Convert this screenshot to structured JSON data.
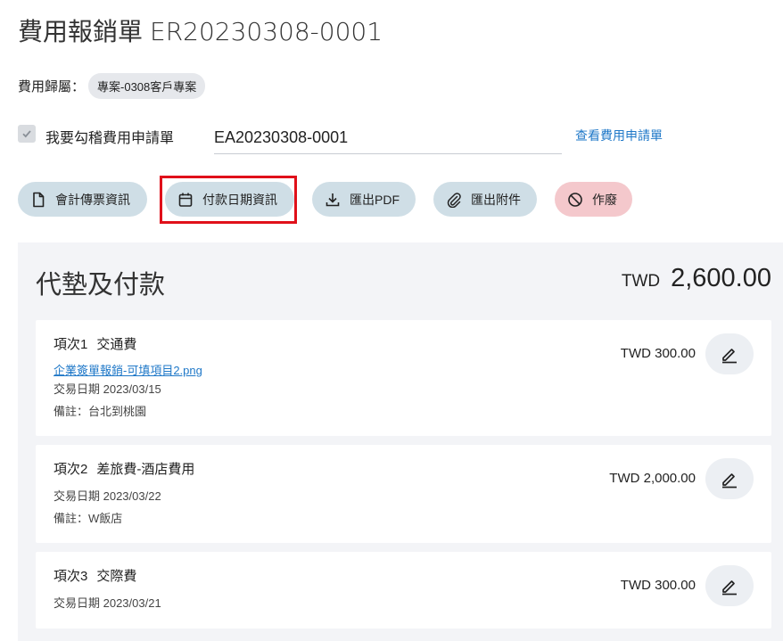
{
  "header": {
    "title": "費用報銷單",
    "doc_number": "ER20230308-0001"
  },
  "owner": {
    "label": "費用歸屬：",
    "chip": "專案-0308客戶專案"
  },
  "apply": {
    "checkbox_label": "我要勾稽費用申請單",
    "checked": true,
    "input_value": "EA20230308-0001",
    "link_label": "查看費用申請單"
  },
  "actions": [
    {
      "label": "會計傳票資訊",
      "icon": "document-icon"
    },
    {
      "label": "付款日期資訊",
      "icon": "calendar-icon"
    },
    {
      "label": "匯出PDF",
      "icon": "download-icon"
    },
    {
      "label": "匯出附件",
      "icon": "paperclip-icon"
    },
    {
      "label": "作廢",
      "icon": "ban-icon"
    }
  ],
  "colors": {
    "accent_link": "#1f78c8",
    "button_bg": "#cfdee6",
    "danger_bg": "#f4c8cc",
    "highlight_border": "#e0101a"
  },
  "section": {
    "title": "代墊及付款",
    "currency": "TWD",
    "total": "2,600.00"
  },
  "items": [
    {
      "index": "項次1",
      "category": "交通費",
      "attachment": "企業簽單報銷-可填項目2.png",
      "date": "交易日期 2023/03/15",
      "note": "備註：台北到桃園",
      "amount": "TWD 300.00"
    },
    {
      "index": "項次2",
      "category": "差旅費-酒店費用",
      "date": "交易日期 2023/03/22",
      "note": "備註：W飯店",
      "amount": "TWD 2,000.00"
    },
    {
      "index": "項次3",
      "category": "交際費",
      "date": "交易日期 2023/03/21",
      "amount": "TWD 300.00"
    }
  ]
}
